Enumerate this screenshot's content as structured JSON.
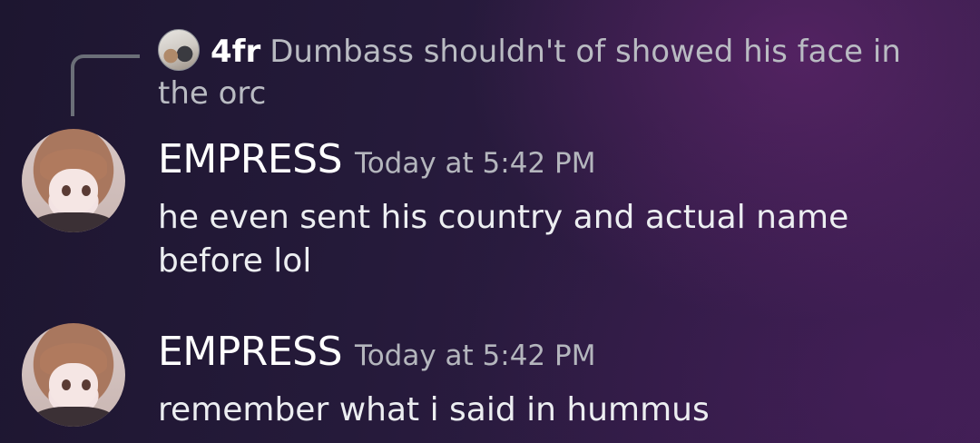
{
  "reply": {
    "author": "4fr",
    "text": "Dumbass shouldn't of showed his face in the orc"
  },
  "messages": [
    {
      "author": "EMPRESS",
      "timestamp": "Today at 5:42 PM",
      "text": "he even sent his country and actual name before lol"
    },
    {
      "author": "EMPRESS",
      "timestamp": "Today at 5:42 PM",
      "text": "remember what i said in hummus"
    }
  ]
}
